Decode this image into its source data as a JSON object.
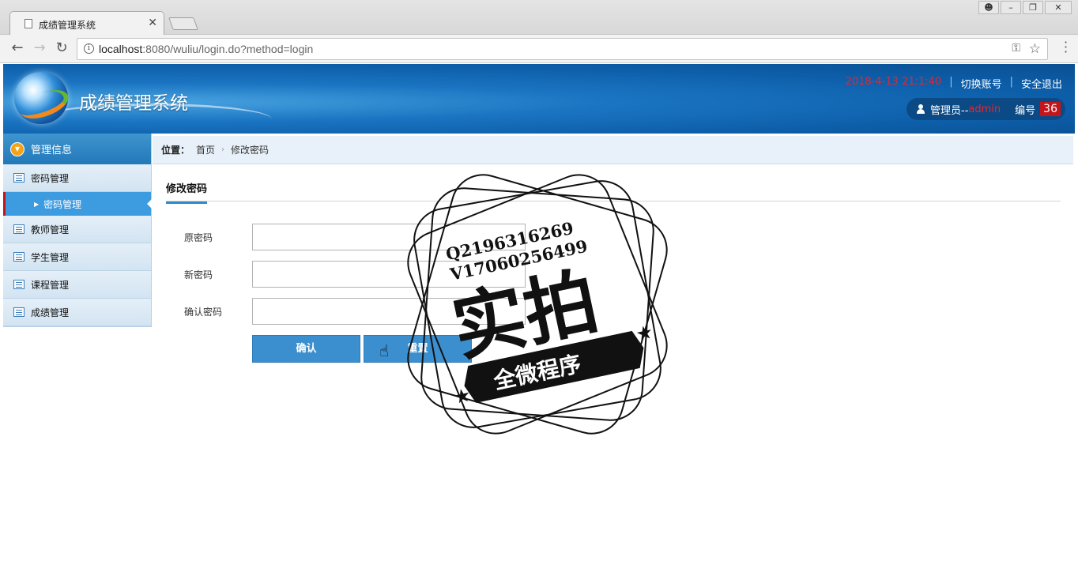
{
  "browser": {
    "tab_title": "成绩管理系统",
    "url_host": "localhost",
    "url_rest": ":8080/wuliu/login.do?method=login"
  },
  "header": {
    "title": "成绩管理系统",
    "datetime": "2018-4-13 21:1:40",
    "switch_account": "切换账号",
    "logout": "安全退出",
    "user_prefix": "管理员--",
    "username": "admin",
    "id_label": "编号",
    "id_value": "36"
  },
  "sidebar": {
    "head": "管理信息",
    "items": [
      {
        "label": "密码管理"
      },
      {
        "label": "密码管理",
        "sub": true,
        "active": true
      },
      {
        "label": "教师管理"
      },
      {
        "label": "学生管理"
      },
      {
        "label": "课程管理"
      },
      {
        "label": "成绩管理"
      }
    ]
  },
  "breadcrumb": {
    "label": "位置：",
    "home": "首页",
    "current": "修改密码"
  },
  "form": {
    "section_title": "修改密码",
    "old_password_label": "原密码",
    "new_password_label": "新密码",
    "confirm_password_label": "确认密码",
    "old_password_value": "",
    "new_password_value": "",
    "confirm_password_value": "",
    "confirm_button": "确认",
    "reset_button": "重置"
  },
  "watermark": {
    "line1": "Q2196316269",
    "line2": "V17060256499",
    "big_text": "实拍",
    "banner": "全微程序"
  },
  "colors": {
    "header_blue": "#0d5ea9",
    "accent_red": "#c3151b",
    "button_blue": "#3b8fce"
  }
}
